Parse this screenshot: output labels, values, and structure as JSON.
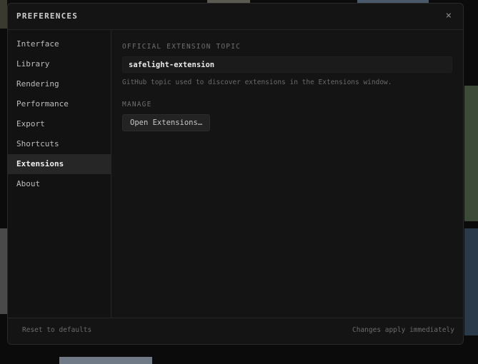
{
  "window": {
    "title": "PREFERENCES",
    "close_glyph": "×"
  },
  "sidebar": {
    "items": [
      {
        "label": "Interface"
      },
      {
        "label": "Library"
      },
      {
        "label": "Rendering"
      },
      {
        "label": "Performance"
      },
      {
        "label": "Export"
      },
      {
        "label": "Shortcuts"
      },
      {
        "label": "Extensions",
        "active": true
      },
      {
        "label": "About"
      }
    ]
  },
  "extensions": {
    "topic_label": "OFFICIAL EXTENSION TOPIC",
    "topic_value": "safelight-extension",
    "topic_hint": "GitHub topic used to discover extensions in the Extensions window.",
    "manage_label": "MANAGE",
    "open_button": "Open Extensions…"
  },
  "footer": {
    "reset_label": "Reset to defaults",
    "status_text": "Changes apply immediately"
  },
  "colors": {
    "background": "#141414",
    "active_item": "#262626",
    "accent_text": "#f0f0f0"
  }
}
